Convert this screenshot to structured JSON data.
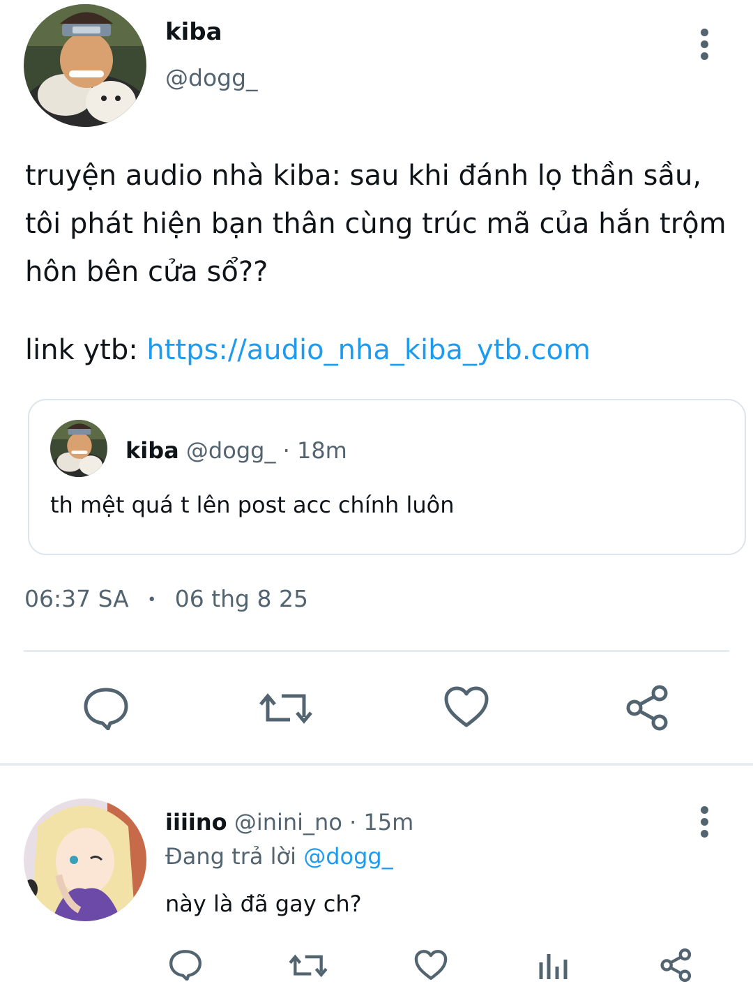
{
  "tweet": {
    "author_name": "kiba",
    "author_handle": "@dogg_",
    "body_line1": "truyện audio nhà kiba: sau khi đánh lọ thần sầu,",
    "body_line2": "tôi phát hiện bạn thân cùng trúc mã của hắn trộm",
    "body_line3": "hôn bên cửa sổ??",
    "link_prefix": "link ytb: ",
    "link_text": "https://audio_nha_kiba_ytb.com",
    "timestamp_time": "06:37 SA",
    "timestamp_sep": "•",
    "timestamp_date": "06 thg 8 25"
  },
  "quote": {
    "author_name": "kiba",
    "author_handle": "@dogg_",
    "time": "· 18m",
    "text": "th mệt quá t lên post acc chính luôn"
  },
  "actions": {
    "icons": [
      "reply-icon",
      "retweet-icon",
      "like-icon",
      "share-icon"
    ]
  },
  "reply": {
    "author_name": "iiiino",
    "author_handle": "@inini_no",
    "time": "· 15m",
    "replying_prefix": "Đang trả lời ",
    "replying_to": "@dogg_",
    "text": "này là đã gay ch?",
    "icons": [
      "reply-icon",
      "retweet-icon",
      "like-icon",
      "views-icon",
      "share-icon"
    ]
  },
  "colors": {
    "text": "#0f1419",
    "secondary": "#536471",
    "link": "#1d9bf0",
    "divider": "#e6ecf0"
  }
}
